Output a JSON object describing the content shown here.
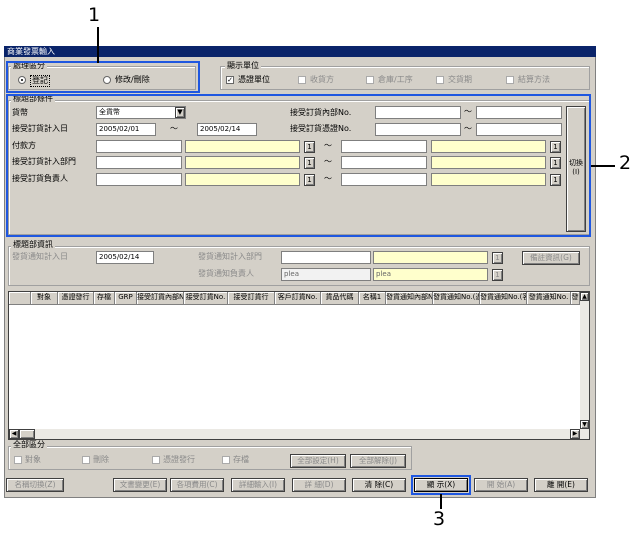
{
  "window_title": "商業發票輸入",
  "callouts": [
    "1",
    "2",
    "3"
  ],
  "process_section": {
    "label": "處理區分",
    "options": [
      {
        "label": "登記",
        "selected": true
      },
      {
        "label": "修改/刪除",
        "selected": false
      }
    ]
  },
  "display_units": {
    "label": "顯示單位",
    "items": [
      {
        "label": "憑證單位",
        "checked": true,
        "enabled": true
      },
      {
        "label": "收貨方",
        "checked": false,
        "enabled": false
      },
      {
        "label": "倉庫/工序",
        "checked": false,
        "enabled": false
      },
      {
        "label": "交貨期",
        "checked": false,
        "enabled": false
      },
      {
        "label": "結算方法",
        "checked": false,
        "enabled": false
      }
    ]
  },
  "header_conditions": {
    "label": "標題部條件",
    "currency_label": "貨幣",
    "currency_value": "全貨幣",
    "receive_date_label": "接受訂貨計入日",
    "date_from": "2005/02/01",
    "date_to": "2005/02/14",
    "range_sep": "～",
    "order_no_label": "接受訂貨內部No.",
    "cert_no_label": "接受訂貨憑證No.",
    "payer_label": "付款方",
    "dept_label": "接受訂貨計入部門",
    "person_label": "接受訂貨負責人",
    "switch_label": "切換(I)"
  },
  "header_info": {
    "label": "標題部資訊",
    "notice_date_label": "發貨通知計入日",
    "notice_date_value": "2005/02/14",
    "notice_dept_label": "發貨通知計入部門",
    "notice_person_label": "發貨通知負責人",
    "notice_person_value1": "plea",
    "notice_person_value2": "plea",
    "remark_button": "備註資訊(G)"
  },
  "table": {
    "columns": [
      "對象",
      "憑證發行",
      "存檔",
      "GRP",
      "接受訂貨內部No.",
      "接受訂貨No.",
      "接受訂貨行",
      "客戶訂貨No.",
      "貨品代碼",
      "名稱1",
      "發貨通知內部No.",
      "發貨通知No.(憑證)",
      "發貨通知No.(客戶)",
      "發貨通知No.",
      "發"
    ]
  },
  "all_section": {
    "label": "全部區分",
    "checks": [
      "對象",
      "刪除",
      "憑證發行",
      "存檔"
    ],
    "select_all": "全部設定(H)",
    "clear_all": "全部解除(J)"
  },
  "footer_buttons": [
    {
      "label": "名稱切換(Z)",
      "enabled": false
    },
    {
      "label": "文書變更(E)",
      "enabled": false
    },
    {
      "label": "各項費用(C)",
      "enabled": false
    },
    {
      "label": "詳細輸入(I)",
      "enabled": false
    },
    {
      "label": "詳 細(D)",
      "enabled": false
    },
    {
      "label": "清 除(C)",
      "enabled": true
    },
    {
      "label": "顯 示(X)",
      "enabled": true
    },
    {
      "label": "開 始(A)",
      "enabled": false
    },
    {
      "label": "離 開(E)",
      "enabled": true
    }
  ]
}
